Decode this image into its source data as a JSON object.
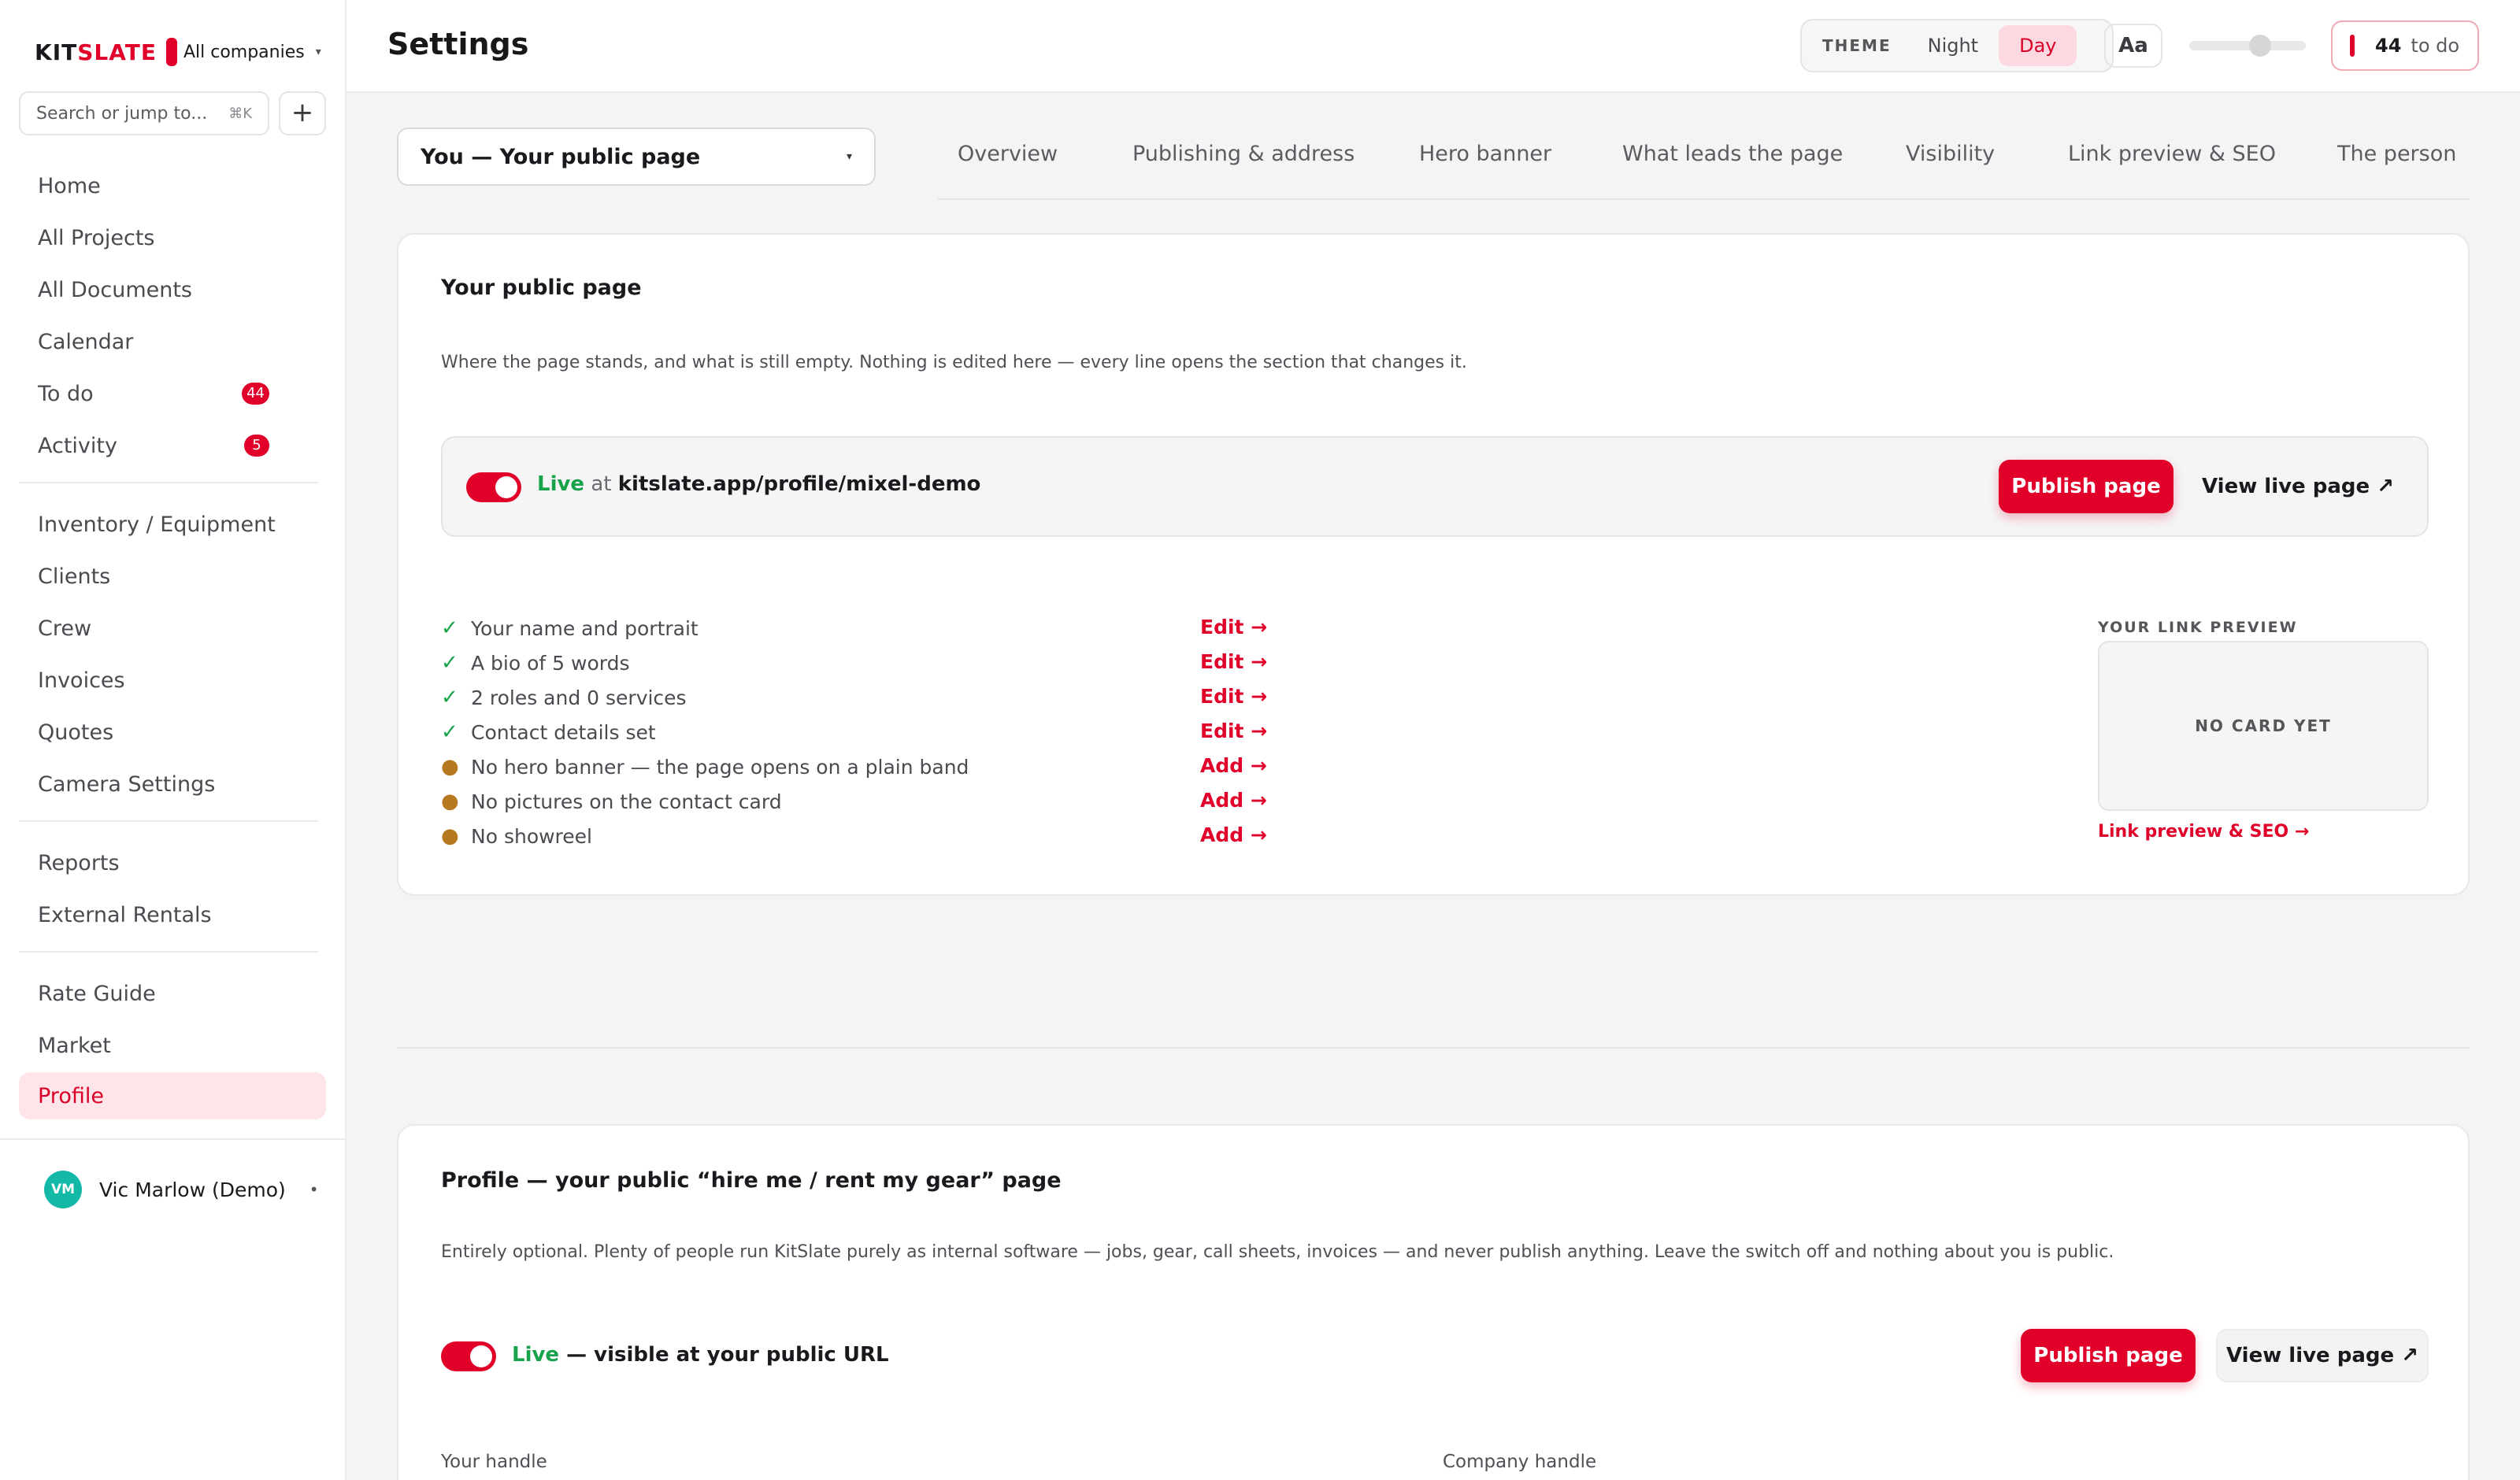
{
  "brand": {
    "name_left": "KIT",
    "name_right": "SLATE",
    "company": "All companies",
    "company_caret": "▾"
  },
  "search": {
    "placeholder": "Search or jump to...",
    "shortcut": "⌘K",
    "add_label": "+"
  },
  "nav": {
    "home": "Home",
    "all_projects": "All Projects",
    "all_documents": "All Documents",
    "calendar": "Calendar",
    "todo": "To do",
    "todo_badge": "44",
    "activity": "Activity",
    "activity_badge": "5",
    "inventory": "Inventory / Equipment",
    "clients": "Clients",
    "crew": "Crew",
    "invoices": "Invoices",
    "quotes": "Quotes",
    "camera_settings": "Camera Settings",
    "reports": "Reports",
    "external_rentals": "External Rentals",
    "rate_guide": "Rate Guide",
    "market": "Market",
    "profile": "Profile"
  },
  "user": {
    "initials": "VM",
    "name": "Vic Marlow (Demo)",
    "menu": "•"
  },
  "header": {
    "title": "Settings",
    "theme_label": "THEME",
    "theme_night": "Night",
    "theme_day": "Day",
    "font_button": "Aa",
    "todo_count": "44",
    "todo_label": "to do"
  },
  "section_select": {
    "value": "You — Your public page",
    "caret": "▾"
  },
  "tabs": [
    "Overview",
    "Publishing & address",
    "Hero banner",
    "What leads the page",
    "Visibility",
    "Link preview & SEO",
    "The person"
  ],
  "summary_card": {
    "title": "Your public page",
    "description": "Where the page stands, and what is still empty. Nothing is edited here — every line opens the section that changes it.",
    "live_word": "Live",
    "live_at": " at ",
    "live_url": "kitslate.app/profile/mixel-demo",
    "publish_label": "Publish page",
    "view_label": "View live page ↗",
    "checklist": [
      {
        "mark": "✓",
        "text": "Your name and portrait",
        "action": "Edit →"
      },
      {
        "mark": "✓",
        "text": "A bio of 5 words",
        "action": "Edit →"
      },
      {
        "mark": "✓",
        "text": "2 roles and 0 services",
        "action": "Edit →"
      },
      {
        "mark": "✓",
        "text": "Contact details set",
        "action": "Edit →"
      },
      {
        "mark": "●",
        "text": "No hero banner — the page opens on a plain band",
        "action": "Add →"
      },
      {
        "mark": "●",
        "text": "No pictures on the contact card",
        "action": "Add →"
      },
      {
        "mark": "●",
        "text": "No showreel",
        "action": "Add →"
      }
    ],
    "preview_label": "YOUR LINK PREVIEW",
    "preview_empty": "NO CARD YET",
    "preview_link": "Link preview & SEO →"
  },
  "profile_card": {
    "title": "Profile — your public “hire me / rent my gear” page",
    "description": "Entirely optional. Plenty of people run KitSlate purely as internal software — jobs, gear, call sheets, invoices — and never publish anything. Leave the switch off and nothing about you is public.",
    "live_word": "Live",
    "live_rest": " — visible at your public URL",
    "publish_label": "Publish page",
    "view_label": "View live page ↗",
    "handle_label": "Your handle",
    "company_handle_label": "Company handle"
  },
  "colors": {
    "accent": "#e0002a",
    "live_green": "#16a34a",
    "pending_amber": "#b7791f",
    "active_bg": "#fde5ea"
  }
}
